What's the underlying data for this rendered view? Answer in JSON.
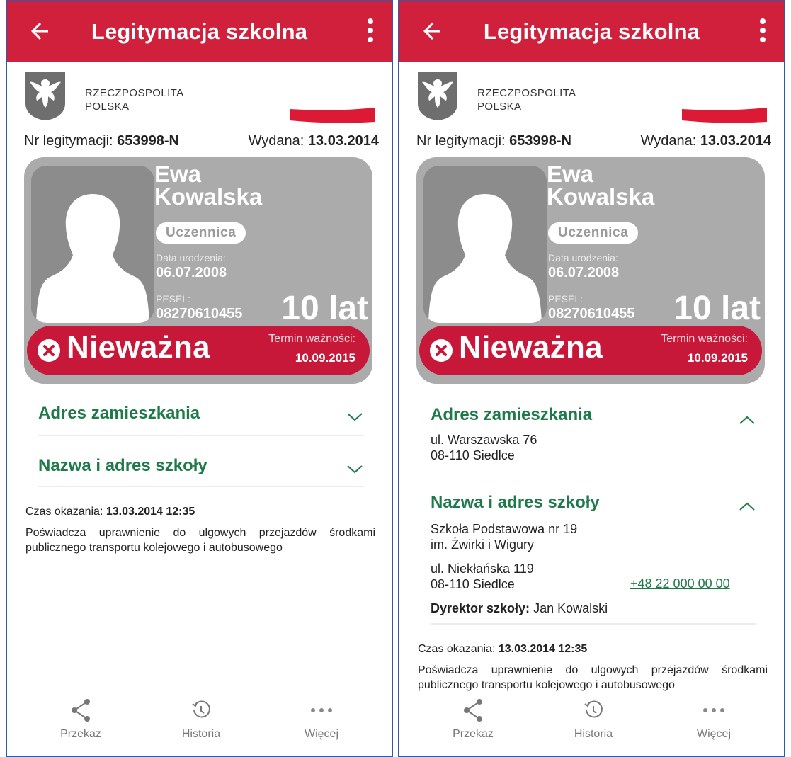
{
  "screens": [
    {
      "appbar": {
        "title": "Legitymacja szkolna"
      },
      "header": {
        "country_line1": "RZECZPOSPOLITA",
        "country_line2": "POLSKA"
      },
      "card_meta": {
        "nr_label": "Nr legitymacji:",
        "nr_value": "653998-N",
        "issued_label": "Wydana:",
        "issued_value": "13.03.2014"
      },
      "card": {
        "first_name": "Ewa",
        "last_name": "Kowalska",
        "role": "Uczennica",
        "dob_label": "Data urodzenia:",
        "dob_value": "06.07.2008",
        "pesel_label": "PESEL:",
        "pesel_value": "08270610455",
        "age": "10 lat",
        "status": "Nieważna",
        "validity_label": "Termin ważności:",
        "validity_value": "10.09.2015"
      },
      "address": {
        "heading": "Adres zamieszkania",
        "expanded": false
      },
      "school": {
        "heading": "Nazwa i adres szkoły",
        "expanded": false
      },
      "footer_info": {
        "shown_label": "Czas okazania:",
        "shown_value": "13.03.2014 12:35",
        "description": "Poświadcza uprawnienie do ulgowych przejazdów środkami publicznego transportu kolejowego i autobusowego"
      },
      "bottom_nav": {
        "share": "Przekaz",
        "history": "Historia",
        "more": "Więcej"
      }
    },
    {
      "appbar": {
        "title": "Legitymacja szkolna"
      },
      "header": {
        "country_line1": "RZECZPOSPOLITA",
        "country_line2": "POLSKA"
      },
      "card_meta": {
        "nr_label": "Nr legitymacji:",
        "nr_value": "653998-N",
        "issued_label": "Wydana:",
        "issued_value": "13.03.2014"
      },
      "card": {
        "first_name": "Ewa",
        "last_name": "Kowalska",
        "role": "Uczennica",
        "dob_label": "Data urodzenia:",
        "dob_value": "06.07.2008",
        "pesel_label": "PESEL:",
        "pesel_value": "08270610455",
        "age": "10 lat",
        "status": "Nieważna",
        "validity_label": "Termin ważności:",
        "validity_value": "10.09.2015"
      },
      "address": {
        "heading": "Adres zamieszkania",
        "expanded": true,
        "line1": "ul. Warszawska 76",
        "line2": "08-110 Siedlce"
      },
      "school": {
        "heading": "Nazwa i adres szkoły",
        "expanded": true,
        "name_line1": "Szkoła Podstawowa nr 19",
        "name_line2": "im. Żwirki i Wigury",
        "addr_line1": "ul. Niekłańska 119",
        "addr_line2": "08-110 Siedlce",
        "phone": "+48 22 000 00 00",
        "director_label": "Dyrektor szkoły:",
        "director_name": "Jan Kowalski"
      },
      "footer_info": {
        "shown_label": "Czas okazania:",
        "shown_value": "13.03.2014 12:35",
        "description": "Poświadcza uprawnienie do ulgowych przejazdów środkami publicznego transportu kolejowego i autobusowego"
      },
      "bottom_nav": {
        "share": "Przekaz",
        "history": "Historia",
        "more": "Więcej"
      }
    }
  ],
  "colors": {
    "brand_red": "#d1203c",
    "status_red": "#c8183a",
    "card_gray": "#ababab",
    "accent_green": "#1f7a4a",
    "frame_blue": "#2f5aa8"
  },
  "icons": [
    "back-arrow-icon",
    "more-vert-icon",
    "eagle-emblem-icon",
    "polish-flag-icon",
    "close-circle-icon",
    "chevron-down-icon",
    "chevron-up-icon",
    "share-icon",
    "history-icon",
    "more-horiz-icon"
  ]
}
